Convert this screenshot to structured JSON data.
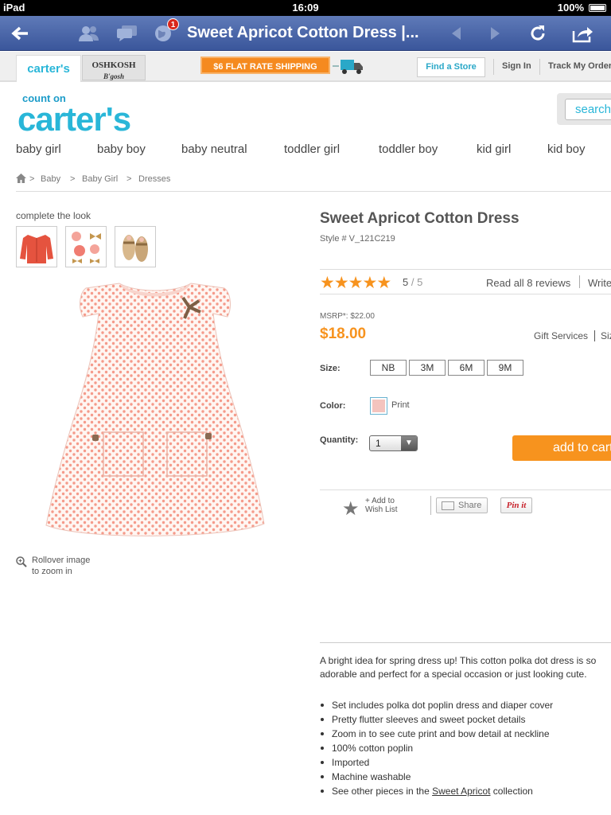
{
  "status": {
    "device": "iPad",
    "time": "16:09",
    "battery": "100%"
  },
  "browser": {
    "title": "Sweet Apricot Cotton Dress |...",
    "notification_count": "1",
    "icons": [
      "back-icon",
      "friends-icon",
      "messages-icon",
      "globe-icon",
      "prev-icon",
      "next-icon",
      "reload-icon",
      "share-icon"
    ]
  },
  "brandbar": {
    "tab_carters": "carter's",
    "tab_oshkosh": "OSHKOSH",
    "tab_oshkosh_sub": "B'gosh",
    "shipping": "$6 FLAT RATE SHIPPING",
    "find_store": "Find a Store",
    "sign_in": "Sign In",
    "track": "Track My Order"
  },
  "logo": {
    "tagline": "count on",
    "name": "carter's"
  },
  "search": {
    "placeholder": "search"
  },
  "nav": [
    "baby girl",
    "baby boy",
    "baby neutral",
    "toddler girl",
    "toddler boy",
    "kid girl",
    "kid boy"
  ],
  "breadcrumb": [
    "Baby",
    "Baby Girl",
    "Dresses"
  ],
  "look": {
    "label": "complete the look"
  },
  "zoom_hint": {
    "line1": "Rollover image",
    "line2": "to zoom in"
  },
  "product": {
    "title": "Sweet Apricot Cotton Dress",
    "style": "Style # V_121C219",
    "rating": 5,
    "rating_text": "5",
    "rating_max": "5",
    "read_reviews": "Read all 8 reviews",
    "write_review": "Write",
    "msrp": "MSRP*: $22.00",
    "price": "$18.00",
    "gift": "Gift Services",
    "size_chart": "Size",
    "size_label": "Size:",
    "sizes": [
      "NB",
      "3M",
      "6M",
      "9M"
    ],
    "color_label": "Color:",
    "color_name": "Print",
    "quantity_label": "Quantity:",
    "quantity": "1",
    "add_to_cart": "add to cart",
    "wishlist_line1": "+ Add to",
    "wishlist_line2": "Wish List",
    "share": "Share",
    "pinit": "Pin it"
  },
  "description": {
    "intro": "A bright idea for spring dress up! This cotton polka dot dress is so adorable and perfect for a special occasion or just looking cute.",
    "bullets": [
      "Set includes polka dot poplin dress and diaper cover",
      "Pretty flutter sleeves and sweet pocket details",
      "Zoom in to see cute print and bow detail at neckline",
      "100% cotton poplin",
      "Imported",
      "Machine washable"
    ],
    "last_pre": "See other pieces in the ",
    "last_link": "Sweet Apricot",
    "last_post": " collection"
  },
  "colors": {
    "accent": "#f7931e",
    "brand": "#29b6d8",
    "toolbar": "#4a66a8"
  }
}
